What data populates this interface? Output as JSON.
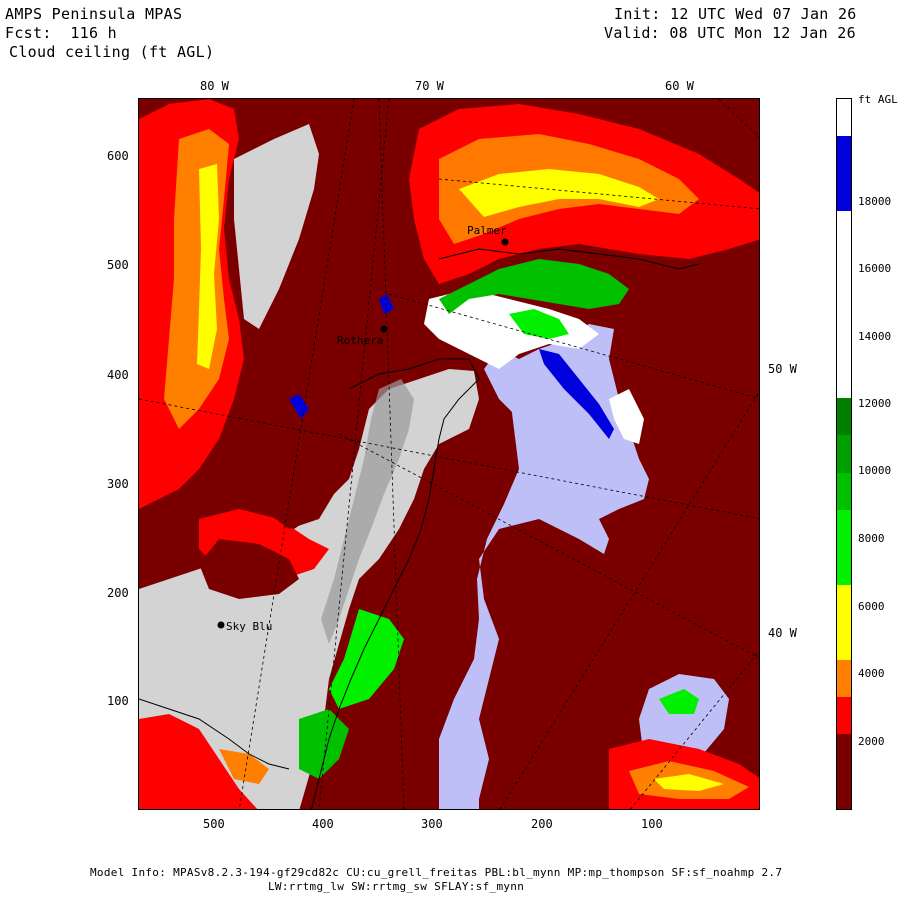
{
  "header": {
    "model_name": "AMPS Peninsula MPAS",
    "forecast": "Fcst:  116 h",
    "field": "Cloud ceiling (ft AGL)",
    "init": "Init: 12 UTC Wed 07 Jan 26",
    "valid": "Valid: 08 UTC Mon 12 Jan 26"
  },
  "map": {
    "top_longitude_labels": [
      "80 W",
      "70 W",
      "60 W"
    ],
    "right_longitude_labels": [
      "50 W",
      "40 W"
    ],
    "y_ticks": [
      "600",
      "500",
      "400",
      "300",
      "200",
      "100"
    ],
    "x_ticks": [
      "500",
      "400",
      "300",
      "200",
      "100"
    ],
    "station_labels": [
      "Palmer",
      "Rothera",
      "Sky Blu"
    ],
    "colors": {
      "background_no_data": "#7a0000",
      "land_ice": "#d3d3d3",
      "sea_ice_lavender": "#bfbff7"
    }
  },
  "colorbar": {
    "unit_label": "ft AGL",
    "tick_labels": [
      "18000",
      "16000",
      "14000",
      "12000",
      "10000",
      "8000",
      "6000",
      "4000",
      "2000"
    ],
    "segments": [
      {
        "color": "#ffffff"
      },
      {
        "color": "#0000dd"
      },
      {
        "color": "#0000dd"
      },
      {
        "color": "#ffffff"
      },
      {
        "color": "#ffffff"
      },
      {
        "color": "#ffffff"
      },
      {
        "color": "#ffffff"
      },
      {
        "color": "#ffffff"
      },
      {
        "color": "#007f00"
      },
      {
        "color": "#00a000"
      },
      {
        "color": "#00c000"
      },
      {
        "color": "#00f000"
      },
      {
        "color": "#00f000"
      },
      {
        "color": "#ffff00"
      },
      {
        "color": "#ffff00"
      },
      {
        "color": "#ff7f00"
      },
      {
        "color": "#ff0000"
      },
      {
        "color": "#7a0000"
      },
      {
        "color": "#7a0000"
      }
    ]
  },
  "footer": {
    "line1": "Model Info: MPASv8.2.3-194-gf29cd82c CU:cu_grell_freitas PBL:bl_mynn MP:mp_thompson SF:sf_noahmp 2.7",
    "line2": "LW:rrtmg_lw SW:rrtmg_sw SFLAY:sf_mynn"
  }
}
